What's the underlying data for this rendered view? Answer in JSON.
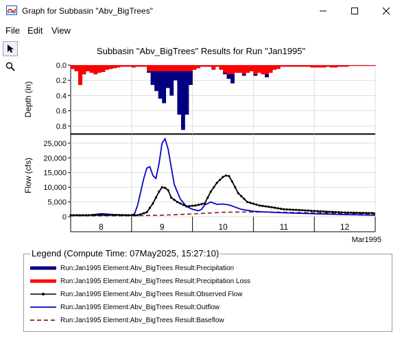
{
  "window": {
    "title": "Graph for Subbasin \"Abv_BigTrees\""
  },
  "menu": {
    "items": [
      "File",
      "Edit",
      "View"
    ]
  },
  "toolbar": {
    "tools": [
      "pointer-tool",
      "zoom-tool"
    ]
  },
  "chart": {
    "title": "Subbasin \"Abv_BigTrees\" Results for Run \"Jan1995\""
  },
  "chart_data": [
    {
      "type": "bar",
      "title": "Subbasin \"Abv_BigTrees\" Results for Run \"Jan1995\"",
      "ylabel": "Depth (in)",
      "ylim": [
        0,
        0.9
      ],
      "y_inverted": true,
      "y_ticks": [
        "0.0",
        "0.2",
        "0.4",
        "0.6",
        "0.8"
      ],
      "x_range_days": [
        7.5,
        12.5
      ],
      "series": [
        {
          "name": "Run:Jan1995 Element:Abv_BigTrees Result:Precipitation",
          "color": "#000080",
          "values": [
            0.05,
            0.08,
            0.26,
            0.12,
            0.08,
            0.1,
            0.12,
            0.1,
            0.09,
            0.06,
            0.05,
            0.04,
            0.03,
            0.02,
            0.02,
            0.02,
            0.03,
            0.02,
            0.02,
            0.02,
            0.1,
            0.26,
            0.34,
            0.44,
            0.5,
            0.3,
            0.4,
            0.2,
            0.65,
            0.85,
            0.65,
            0.26,
            0.06,
            0.04,
            0.02,
            0.02,
            0.02,
            0.06,
            0.02,
            0.06,
            0.12,
            0.18,
            0.24,
            0.1,
            0.1,
            0.14,
            0.1,
            0.08,
            0.14,
            0.1,
            0.12,
            0.16,
            0.1,
            0.06,
            0.05,
            0.02,
            0.02,
            0.02,
            0.02,
            0.02,
            0.02,
            0.02,
            0.02,
            0.03,
            0.03,
            0.03,
            0.03,
            0.02,
            0.03,
            0.03,
            0.02,
            0.02,
            0.02,
            0.01,
            0.01,
            0.01,
            0.01,
            0.01,
            0.01,
            0.01
          ]
        },
        {
          "name": "Run:Jan1995 Element:Abv_BigTrees Result:Precipitation Loss",
          "color": "#ff0000",
          "values": [
            0.05,
            0.08,
            0.26,
            0.12,
            0.08,
            0.1,
            0.12,
            0.1,
            0.09,
            0.06,
            0.05,
            0.04,
            0.03,
            0.02,
            0.02,
            0.02,
            0.03,
            0.02,
            0.02,
            0.02,
            0.08,
            0.08,
            0.08,
            0.08,
            0.08,
            0.08,
            0.08,
            0.08,
            0.08,
            0.08,
            0.08,
            0.08,
            0.06,
            0.04,
            0.02,
            0.02,
            0.02,
            0.06,
            0.02,
            0.06,
            0.1,
            0.12,
            0.12,
            0.1,
            0.1,
            0.12,
            0.1,
            0.08,
            0.12,
            0.1,
            0.12,
            0.12,
            0.1,
            0.06,
            0.05,
            0.02,
            0.02,
            0.02,
            0.02,
            0.02,
            0.02,
            0.02,
            0.02,
            0.03,
            0.03,
            0.03,
            0.03,
            0.02,
            0.03,
            0.03,
            0.02,
            0.02,
            0.02,
            0.01,
            0.01,
            0.01,
            0.01,
            0.01,
            0.01,
            0.01
          ]
        }
      ]
    },
    {
      "type": "line",
      "ylabel": "Flow (cfs)",
      "xlabel": "Mar1995",
      "ylim": [
        0,
        28000
      ],
      "x_range_days": [
        7.5,
        12.5
      ],
      "x_ticks": [
        8,
        9,
        10,
        11,
        12
      ],
      "y_ticks": [
        "0",
        "5,000",
        "10,000",
        "15,000",
        "20,000",
        "25,000"
      ],
      "series": [
        {
          "name": "Run:Jan1995 Element:Abv_BigTrees Result:Observed Flow",
          "color": "#000000",
          "marker": "dot",
          "x": [
            7.5,
            7.8,
            8.1,
            8.4,
            8.6,
            8.75,
            8.85,
            8.95,
            9.0,
            9.05,
            9.1,
            9.15,
            9.25,
            9.4,
            9.55,
            9.7,
            9.8,
            9.9,
            10.0,
            10.05,
            10.1,
            10.15,
            10.25,
            10.4,
            10.6,
            10.8,
            11.0,
            11.3,
            11.6,
            12.0,
            12.5
          ],
          "y": [
            500,
            500,
            600,
            500,
            500,
            1500,
            4500,
            8500,
            10000,
            9800,
            9000,
            6500,
            5000,
            3500,
            3800,
            4500,
            8500,
            11500,
            13500,
            14000,
            13800,
            12000,
            8000,
            5000,
            3800,
            3200,
            2500,
            2200,
            1800,
            1400,
            1200
          ]
        },
        {
          "name": "Run:Jan1995 Element:Abv_BigTrees Result:Outflow",
          "color": "#0000cc",
          "x": [
            7.5,
            7.8,
            8.0,
            8.2,
            8.5,
            8.55,
            8.6,
            8.65,
            8.7,
            8.75,
            8.8,
            8.85,
            8.9,
            8.95,
            9.0,
            9.05,
            9.1,
            9.15,
            9.2,
            9.3,
            9.4,
            9.5,
            9.6,
            9.65,
            9.7,
            9.8,
            9.9,
            10.0,
            10.1,
            10.3,
            10.5,
            10.8,
            11.0,
            11.5,
            12.0,
            12.5
          ],
          "y": [
            500,
            500,
            1000,
            700,
            500,
            1000,
            4000,
            8500,
            13000,
            16500,
            17000,
            14000,
            13000,
            18000,
            25000,
            26500,
            23000,
            17000,
            11000,
            6000,
            3500,
            2500,
            2000,
            2500,
            4000,
            5000,
            4200,
            4300,
            4000,
            2500,
            1800,
            1500,
            1300,
            1000,
            700,
            500
          ]
        },
        {
          "name": "Run:Jan1995 Element:Abv_BigTrees Result:Baseflow",
          "color": "#8b1a1a",
          "dash": "dashed",
          "x": [
            7.5,
            8.5,
            9.0,
            9.5,
            10.0,
            10.5,
            11.0,
            11.5,
            12.0,
            12.5
          ],
          "y": [
            300,
            300,
            500,
            900,
            1500,
            1600,
            1500,
            1300,
            1100,
            900
          ]
        }
      ]
    }
  ],
  "legend": {
    "title": "Legend (Compute Time: 07May2025, 15:27:10)",
    "entries": [
      {
        "label": "Run:Jan1995 Element:Abv_BigTrees Result:Precipitation",
        "color": "#000080",
        "style": "thick"
      },
      {
        "label": "Run:Jan1995 Element:Abv_BigTrees Result:Precipitation Loss",
        "color": "#ff0000",
        "style": "thick"
      },
      {
        "label": "Run:Jan1995 Element:Abv_BigTrees Result:Observed Flow",
        "color": "#000000",
        "style": "dot-line"
      },
      {
        "label": "Run:Jan1995 Element:Abv_BigTrees Result:Outflow",
        "color": "#0000cc",
        "style": "line"
      },
      {
        "label": "Run:Jan1995 Element:Abv_BigTrees Result:Baseflow",
        "color": "#8b1a1a",
        "style": "dashed"
      }
    ]
  }
}
